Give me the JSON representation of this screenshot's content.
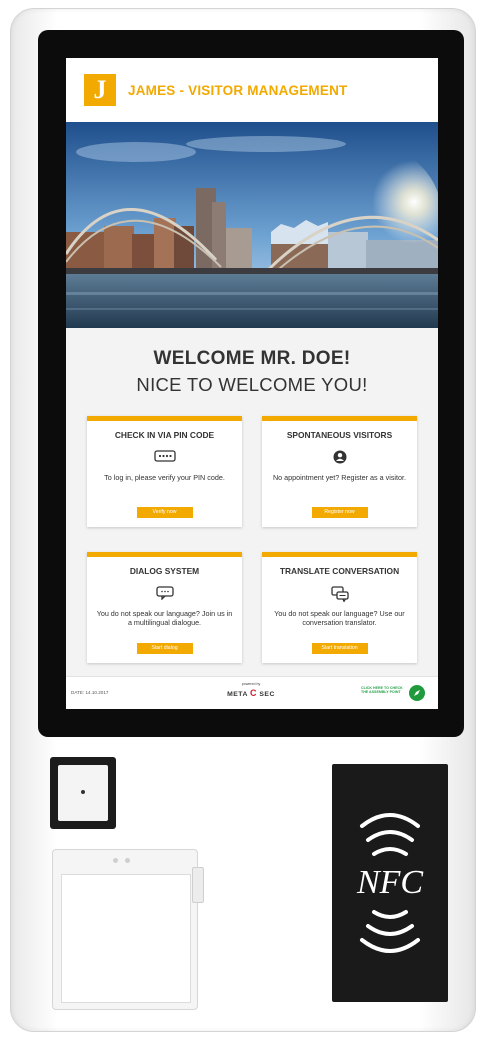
{
  "header": {
    "logo_letter": "J",
    "title": "JAMES - VISITOR MANAGEMENT"
  },
  "welcome": {
    "line1": "WELCOME MR. DOE!",
    "line2": "NICE TO WELCOME YOU!"
  },
  "cards": [
    {
      "title": "CHECK IN VIA PIN CODE",
      "icon": "pin-keypad-icon",
      "description": "To log in, please verify your PIN code.",
      "button": "Verify now"
    },
    {
      "title": "SPONTANEOUS VISITORS",
      "icon": "user-icon",
      "description": "No appointment yet? Register as a visitor.",
      "button": "Register now"
    },
    {
      "title": "DIALOG SYSTEM",
      "icon": "chat-bubble-icon",
      "description": "You do not speak our language? Join us in a multilingual dialogue.",
      "button": "Start dialog"
    },
    {
      "title": "TRANSLATE CONVERSATION",
      "icon": "translate-chat-icon",
      "description": "You do not speak our language? Use our conversation translator.",
      "button": "Start translation"
    }
  ],
  "footer": {
    "date": "DATE: 14.10.2017",
    "powered_by": "powered by",
    "brand_left": "META",
    "brand_c": "C",
    "brand_right": "SEC",
    "assembly_text": "CLICK HERE TO CHECK THE ASSEMBLY POINT",
    "assembly_icon": "compass-icon"
  },
  "hardware": {
    "nfc_label": "NFC"
  },
  "colors": {
    "accent": "#f2a900",
    "text": "#333333",
    "assembly_green": "#1f9b3e",
    "bezel": "#0c0c0d"
  }
}
